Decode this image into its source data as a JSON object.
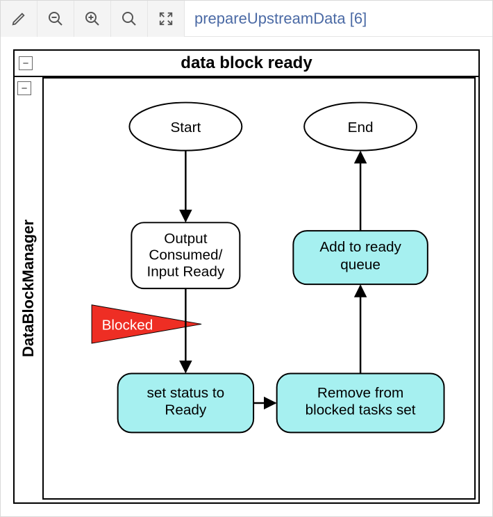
{
  "toolbar": {
    "breadcrumb": "prepareUpstreamData [6]"
  },
  "diagram": {
    "outer_title": "data block ready",
    "swimlane_label": "DataBlockManager",
    "nodes": {
      "start": "Start",
      "end": "End",
      "output_consumed_line1": "Output",
      "output_consumed_line2": "Consumed/",
      "output_consumed_line3": "Input Ready",
      "blocked": "Blocked",
      "set_ready_line1": "set status to",
      "set_ready_line2": "Ready",
      "remove_line1": "Remove from",
      "remove_line2": "blocked tasks set",
      "add_queue_line1": "Add to ready",
      "add_queue_line2": "queue"
    },
    "collapse_glyph": "−"
  }
}
